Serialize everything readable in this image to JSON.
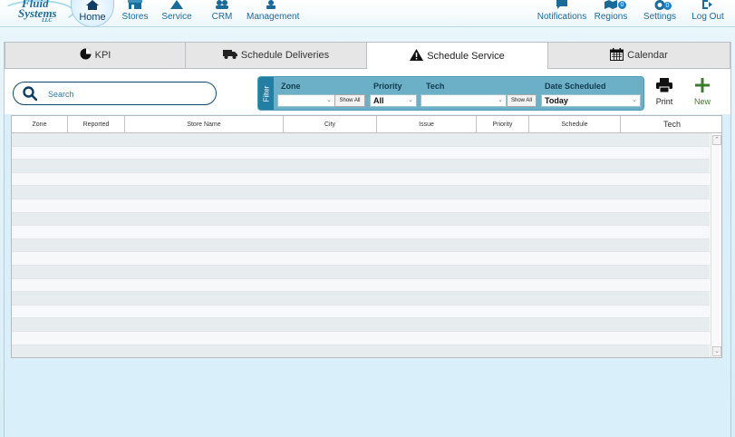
{
  "brand": {
    "line1": "Fluid",
    "line2": "Systems",
    "line3": "LLC"
  },
  "nav": {
    "home": "Home",
    "stores": "Stores",
    "service": "Service",
    "crm": "CRM",
    "management": "Management",
    "notifications": "Notifications",
    "regions": "Regions",
    "regions_badge": "0",
    "settings": "Settings",
    "settings_badge": "0",
    "logout": "Log Out"
  },
  "tabs": [
    {
      "label": "KPI",
      "icon": "pie-chart-icon"
    },
    {
      "label": "Schedule Deliveries",
      "icon": "truck-icon"
    },
    {
      "label": "Schedule Service",
      "icon": "warning-icon",
      "active": true
    },
    {
      "label": "Calendar",
      "icon": "calendar-icon"
    }
  ],
  "search": {
    "placeholder": "Search"
  },
  "filter": {
    "tag": "Filter",
    "zone": {
      "label": "Zone",
      "value": "",
      "show_all": "Show All"
    },
    "priority": {
      "label": "Priority",
      "value": "All"
    },
    "tech": {
      "label": "Tech",
      "value": "",
      "show_all": "Show All"
    },
    "date": {
      "label": "Date Scheduled",
      "value": "Today"
    }
  },
  "actions": {
    "print": "Print",
    "new": "New"
  },
  "table": {
    "columns": [
      "Zone",
      "Reported",
      "Store Name",
      "City",
      "Issue",
      "Priority",
      "Schedule",
      "Tech"
    ]
  },
  "colors": {
    "accent": "#237ea3",
    "filter_bg": "#6bb0c7",
    "new_green": "#3b7d2c",
    "nav_text": "#1a6a9a"
  }
}
